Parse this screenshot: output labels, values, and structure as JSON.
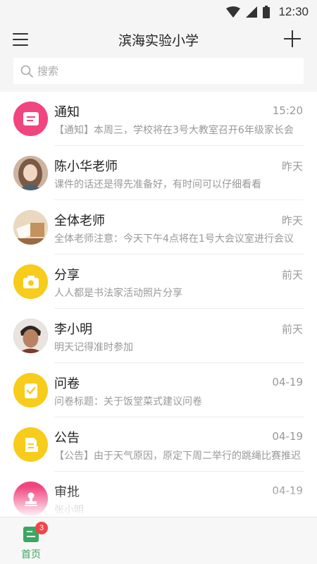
{
  "status_bar": {
    "time": "12:30"
  },
  "header": {
    "title": "滨海实验小学"
  },
  "search": {
    "placeholder": "搜索"
  },
  "conversations": [
    {
      "name": "通知",
      "time": "15:20",
      "preview": "【通知】本周三，学校将在3号大教室召开6年级家长会",
      "icon": "notice-icon",
      "color": "#f0457e"
    },
    {
      "name": "陈小华老师",
      "time": "昨天",
      "preview": "课件的话还是得先准备好，有时间可以仔细看看",
      "icon": "woman-photo",
      "color": "#d9b49a"
    },
    {
      "name": "全体老师",
      "time": "昨天",
      "preview": "全体老师注意：今天下午4点将在1号大会议室进行会议",
      "icon": "group-photo",
      "color": "#e2c9a8"
    },
    {
      "name": "分享",
      "time": "前天",
      "preview": "人人都是书法家活动照片分享",
      "icon": "camera-icon",
      "color": "#f7cc1b"
    },
    {
      "name": "李小明",
      "time": "前天",
      "preview": "明天记得准时参加",
      "icon": "man-photo",
      "color": "#8a6a55"
    },
    {
      "name": "问卷",
      "time": "04-19",
      "preview": "问卷标题：关于饭堂菜式建议问卷",
      "icon": "survey-icon",
      "color": "#f7cc1b"
    },
    {
      "name": "公告",
      "time": "04-19",
      "preview": "【公告】由于天气原因，原定下周二举行的跳绳比赛推迟",
      "icon": "announcement-icon",
      "color": "#f7cc1b"
    },
    {
      "name": "审批",
      "time": "04-19",
      "preview": "张小明",
      "icon": "approval-icon",
      "color": "#f0457e"
    }
  ],
  "tabbar": {
    "home_label": "首页",
    "badge": "3",
    "accent": "#3aa860"
  }
}
